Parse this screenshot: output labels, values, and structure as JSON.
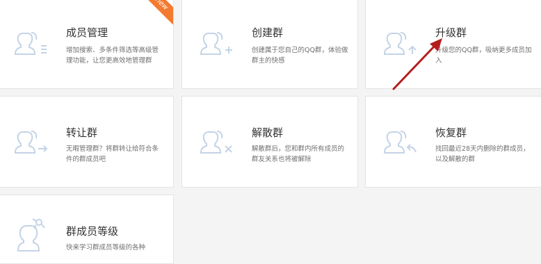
{
  "cards": [
    {
      "title": "成员管理",
      "desc": "增加搜索、多条件筛选等高级管理功能，让您更高效地管理群",
      "badge": "new",
      "icon": "members-list-icon"
    },
    {
      "title": "创建群",
      "desc": "创建属于您自己的QQ群，体验做群主的快感",
      "icon": "create-group-icon"
    },
    {
      "title": "升级群",
      "desc": "升级您的QQ群，吸纳更多成员加入",
      "icon": "upgrade-group-icon"
    },
    {
      "title": "转让群",
      "desc": "无暇管理群？将群转让给符合条件的群成员吧",
      "icon": "transfer-group-icon"
    },
    {
      "title": "解散群",
      "desc": "解散群后，您和群内所有成员的群友关系也将被解除",
      "icon": "dissolve-group-icon"
    },
    {
      "title": "恢复群",
      "desc": "找回最近28天内删除的群成员，以及解散的群",
      "icon": "restore-group-icon"
    },
    {
      "title": "群成员等级",
      "desc": "快来学习群成员等级的各种",
      "icon": "member-level-icon"
    }
  ],
  "colors": {
    "icon_stroke": "#c3d3e6",
    "badge": "#f47a30",
    "arrow": "#b51d1d"
  }
}
